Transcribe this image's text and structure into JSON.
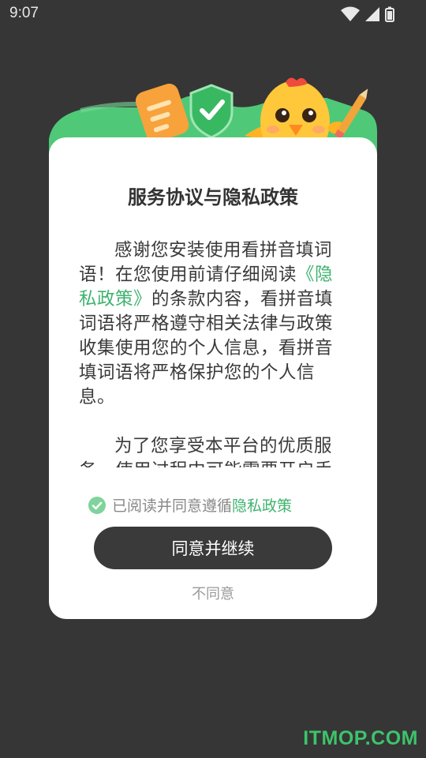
{
  "status_bar": {
    "time": "9:07",
    "icons": [
      "wifi-icon",
      "signal-icon",
      "battery-icon"
    ]
  },
  "dialog": {
    "title": "服务协议与隐私政策",
    "paragraph1": {
      "lead": "感谢您安装使用看拼音填词语！在您使用前请仔细阅读",
      "link": "《隐私政策》",
      "tail": "的条款内容，看拼音填词语将严格遵守相关法律与政策收集使用您的个人信息，看拼音填词语将严格保护您的个人信息。"
    },
    "paragraph2": "为了您享受本平台的优质服务，使用过程中可能需要开启手",
    "consent": {
      "prefix": "已阅读并同意遵循",
      "link": "隐私政策"
    },
    "agree_label": "同意并继续",
    "disagree_label": "不同意"
  },
  "watermark": "ITMOP.COM",
  "colors": {
    "background": "#363636",
    "accent_green": "#3fb36f",
    "button_dark": "#3a3a3a"
  }
}
